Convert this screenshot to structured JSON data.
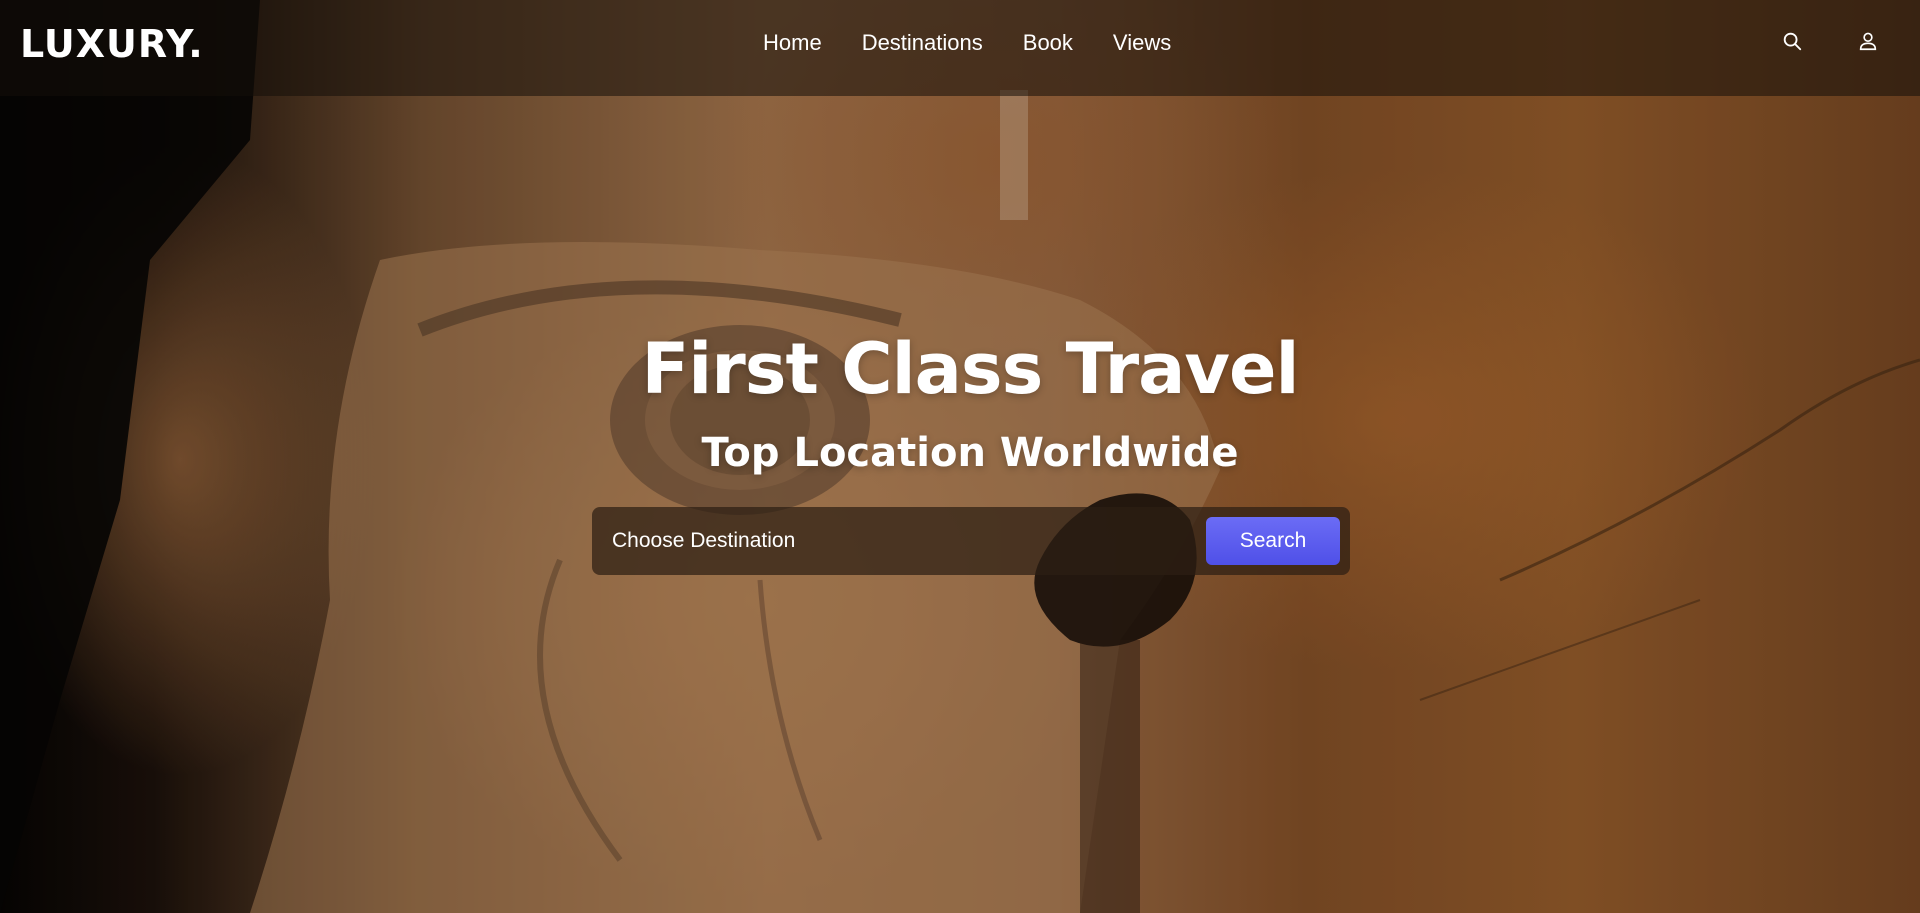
{
  "brand": {
    "logo_text": "LUXURY."
  },
  "nav": {
    "items": [
      {
        "label": "Home"
      },
      {
        "label": "Destinations"
      },
      {
        "label": "Book"
      },
      {
        "label": "Views"
      }
    ]
  },
  "header_icons": {
    "search_icon": "search-icon",
    "account_icon": "user-icon"
  },
  "hero": {
    "title": "First Class Travel",
    "subtitle": "Top Location Worldwide",
    "background_image": "close-up of ancient Egyptian sandstone statue eye"
  },
  "search": {
    "placeholder": "Choose Destination",
    "button_label": "Search"
  },
  "colors": {
    "accent": "#5b5cf0",
    "text": "#ffffff",
    "topbar": "#1e1510"
  }
}
